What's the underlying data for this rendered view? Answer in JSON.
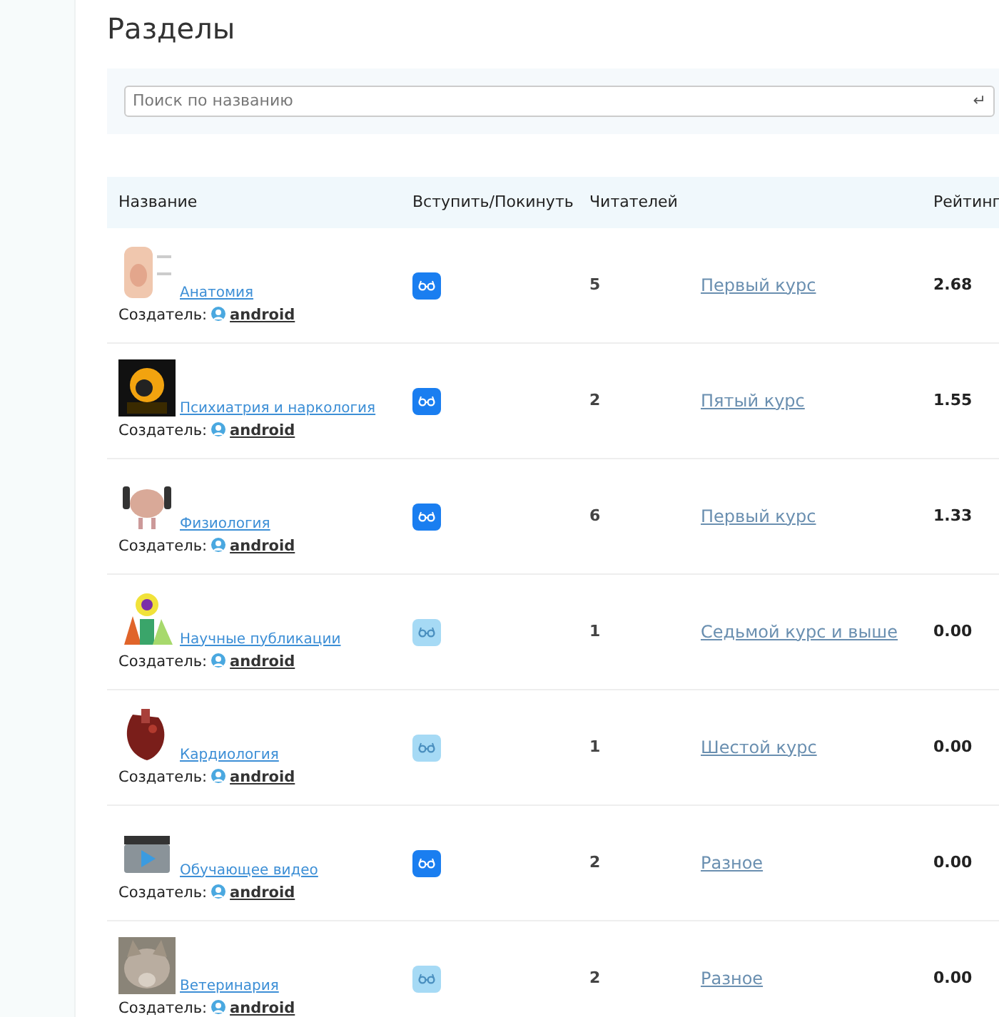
{
  "title": "Разделы",
  "search": {
    "placeholder": "Поиск по названию",
    "submit_icon": "↵"
  },
  "table": {
    "columns": [
      "Название",
      "Вступить/Покинуть",
      "Читателей",
      "Рейтинг"
    ],
    "rows": [
      {
        "name": "Анатомия",
        "creator_label": "Создатель:",
        "creator": "android",
        "joined": true,
        "readers": "5",
        "course": "Первый курс",
        "rating": "2.68"
      },
      {
        "name": "Психиатрия и наркология",
        "creator_label": "Создатель:",
        "creator": "android",
        "joined": true,
        "readers": "2",
        "course": "Пятый курс",
        "rating": "1.55"
      },
      {
        "name": "Физиология",
        "creator_label": "Создатель:",
        "creator": "android",
        "joined": true,
        "readers": "6",
        "course": "Первый курс",
        "rating": "1.33"
      },
      {
        "name": "Научные публикации",
        "creator_label": "Создатель:",
        "creator": "android",
        "joined": false,
        "readers": "1",
        "course": "Седьмой курс и выше",
        "rating": "0.00"
      },
      {
        "name": "Кардиология",
        "creator_label": "Создатель:",
        "creator": "android",
        "joined": false,
        "readers": "1",
        "course": "Шестой курс",
        "rating": "0.00"
      },
      {
        "name": "Обучающее видео",
        "creator_label": "Создатель:",
        "creator": "android",
        "joined": true,
        "readers": "2",
        "course": "Разное",
        "rating": "0.00"
      },
      {
        "name": "Ветеринария",
        "creator_label": "Создатель:",
        "creator": "android",
        "joined": false,
        "readers": "2",
        "course": "Разное",
        "rating": "0.00"
      }
    ]
  }
}
